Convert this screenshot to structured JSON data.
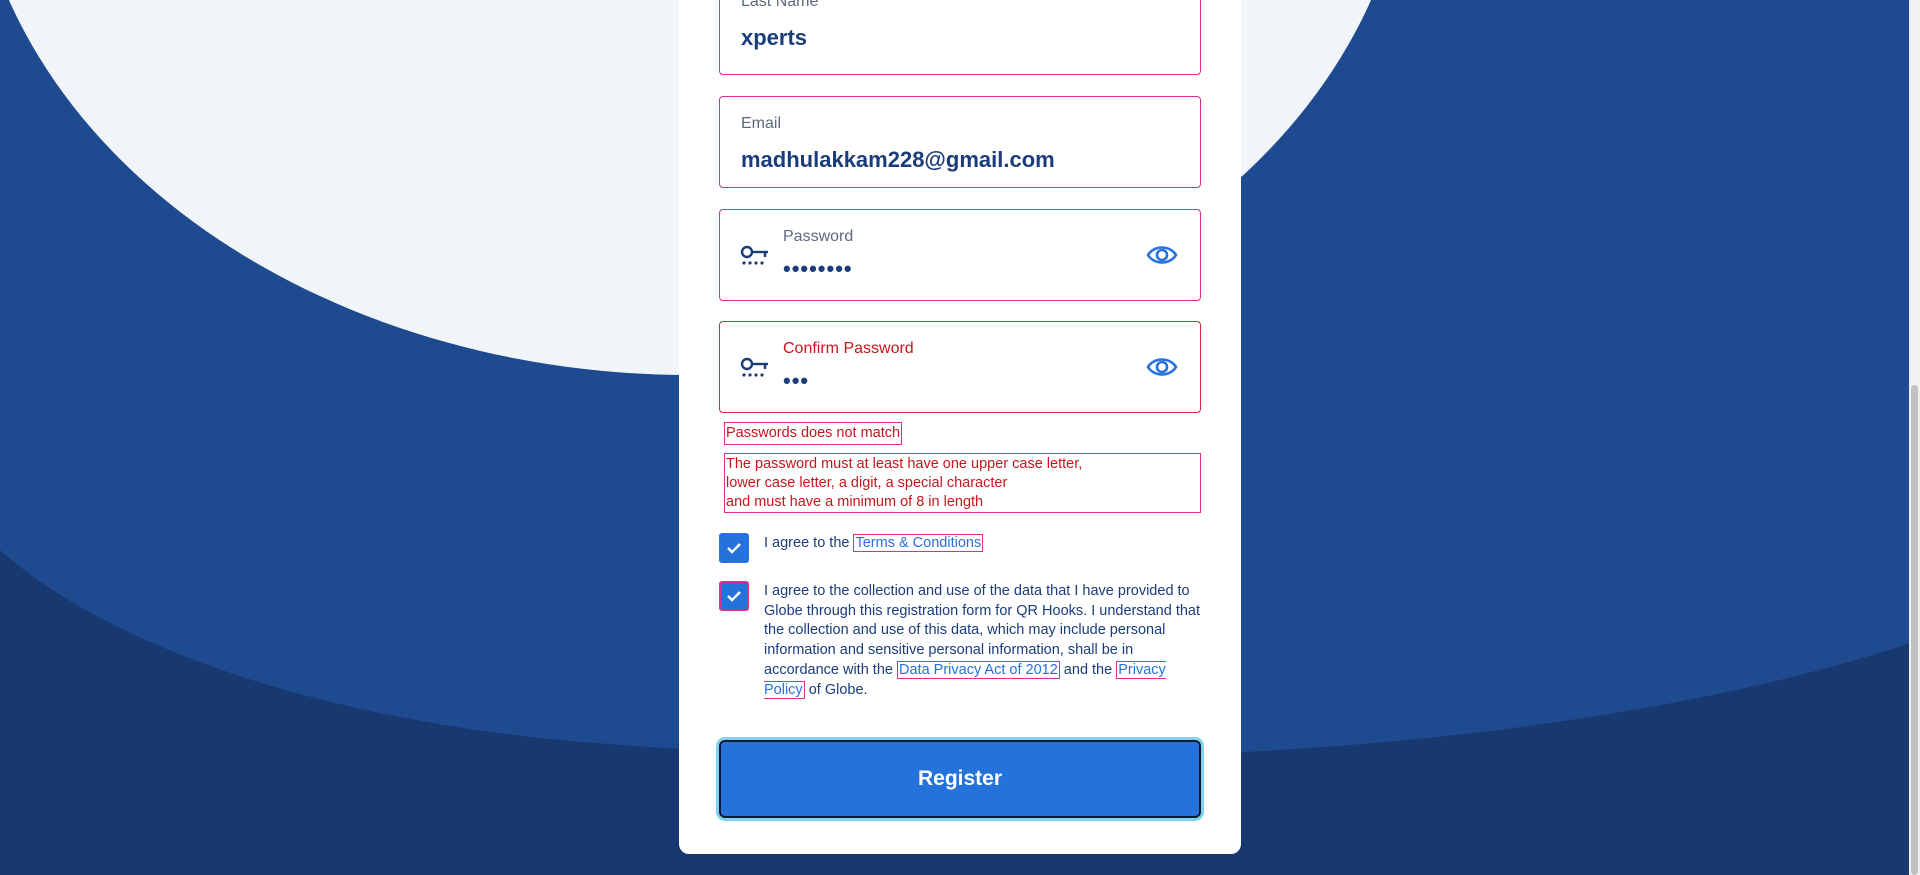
{
  "form": {
    "last_name": {
      "label": "Last Name",
      "value": "xperts"
    },
    "email": {
      "label": "Email",
      "value": "madhulakkam228@gmail.com"
    },
    "password": {
      "label": "Password",
      "value": "••••••••"
    },
    "confirm_password": {
      "label": "Confirm Password",
      "value": "•••"
    },
    "errors": {
      "mismatch": "Passwords does not match",
      "rules_line1": "The password must at least have one upper case letter,",
      "rules_line2": "lower case letter, a digit, a special character",
      "rules_line3": "and must have a minimum of 8 in length"
    },
    "terms": {
      "prefix": "I agree to the ",
      "link": "Terms & Conditions"
    },
    "privacy": {
      "text1": "I agree to the collection and use of the data that I have provided to Globe through this registration form for QR Hooks. I understand that the collection and use of this data, which may include personal information and sensitive personal information, shall be in accordance with the ",
      "link1": "Data Privacy Act of 2012",
      "text2": " and the ",
      "link2": "Privacy Policy",
      "text3": " of Globe."
    },
    "register_label": "Register"
  },
  "colors": {
    "accent": "#2672dd",
    "navy": "#1b3c7c",
    "error": "#c7161e",
    "outline": "#d63384"
  }
}
